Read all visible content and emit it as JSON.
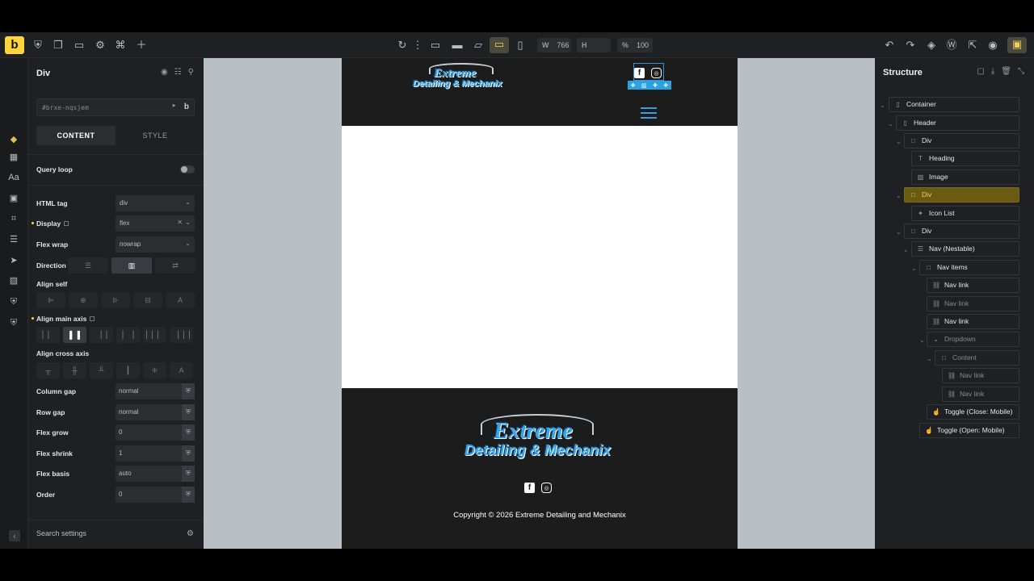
{
  "toolbar": {
    "logo": "b",
    "width_label": "W",
    "width_value": "766",
    "height_label": "H",
    "height_value": "",
    "zoom_label": "%",
    "zoom_value": "100"
  },
  "left_panel": {
    "title": "Div",
    "element_id": "#brxe-nqsjem",
    "id_badge": "b",
    "tabs": [
      "CONTENT",
      "STYLE"
    ],
    "query_loop": "Query loop",
    "html_tag": {
      "label": "HTML tag",
      "value": "div"
    },
    "display": {
      "label": "Display",
      "value": "flex"
    },
    "flex_wrap": {
      "label": "Flex wrap",
      "value": "nowrap"
    },
    "direction": "Direction",
    "align_self": "Align self",
    "align_main_axis": "Align main axis",
    "align_cross_axis": "Align cross axis",
    "column_gap": {
      "label": "Column gap",
      "value": "normal"
    },
    "row_gap": {
      "label": "Row gap",
      "value": "normal"
    },
    "flex_grow": {
      "label": "Flex grow",
      "value": "0"
    },
    "flex_shrink": {
      "label": "Flex shrink",
      "value": "1"
    },
    "flex_basis": {
      "label": "Flex basis",
      "value": "auto"
    },
    "order": {
      "label": "Order",
      "value": "0"
    },
    "search": "Search settings"
  },
  "site": {
    "brand_line1": "Extreme",
    "brand_line2": "Detailing & Mechanix",
    "copyright": "Copyright © 2026 Extreme Detailing and Mechanix"
  },
  "structure": {
    "title": "Structure",
    "nodes": [
      {
        "label": "Container",
        "icon": "container-icon"
      },
      {
        "label": "Header",
        "icon": "container-icon"
      },
      {
        "label": "Div",
        "icon": "div-icon"
      },
      {
        "label": "Heading",
        "icon": "heading-icon"
      },
      {
        "label": "Image",
        "icon": "image-icon"
      },
      {
        "label": "Div",
        "icon": "div-icon"
      },
      {
        "label": "Icon List",
        "icon": "icon-list-icon"
      },
      {
        "label": "Div",
        "icon": "div-icon"
      },
      {
        "label": "Nav (Nestable)",
        "icon": "nav-icon"
      },
      {
        "label": "Nav items",
        "icon": "div-icon"
      },
      {
        "label": "Nav link",
        "icon": "link-icon"
      },
      {
        "label": "Nav link",
        "icon": "link-icon"
      },
      {
        "label": "Nav link",
        "icon": "link-icon"
      },
      {
        "label": "Dropdown",
        "icon": "dropdown-icon"
      },
      {
        "label": "Content",
        "icon": "div-icon"
      },
      {
        "label": "Nav link",
        "icon": "link-icon"
      },
      {
        "label": "Nav link",
        "icon": "link-icon"
      },
      {
        "label": "Toggle (Close: Mobile)",
        "icon": "toggle-icon"
      },
      {
        "label": "Toggle (Open: Mobile)",
        "icon": "toggle-icon"
      }
    ]
  },
  "colors": {
    "accent": "#ffd53d",
    "selection": "#2aa3e0",
    "highlight": "#6a5a12",
    "site_dark": "#1c1c1c"
  }
}
